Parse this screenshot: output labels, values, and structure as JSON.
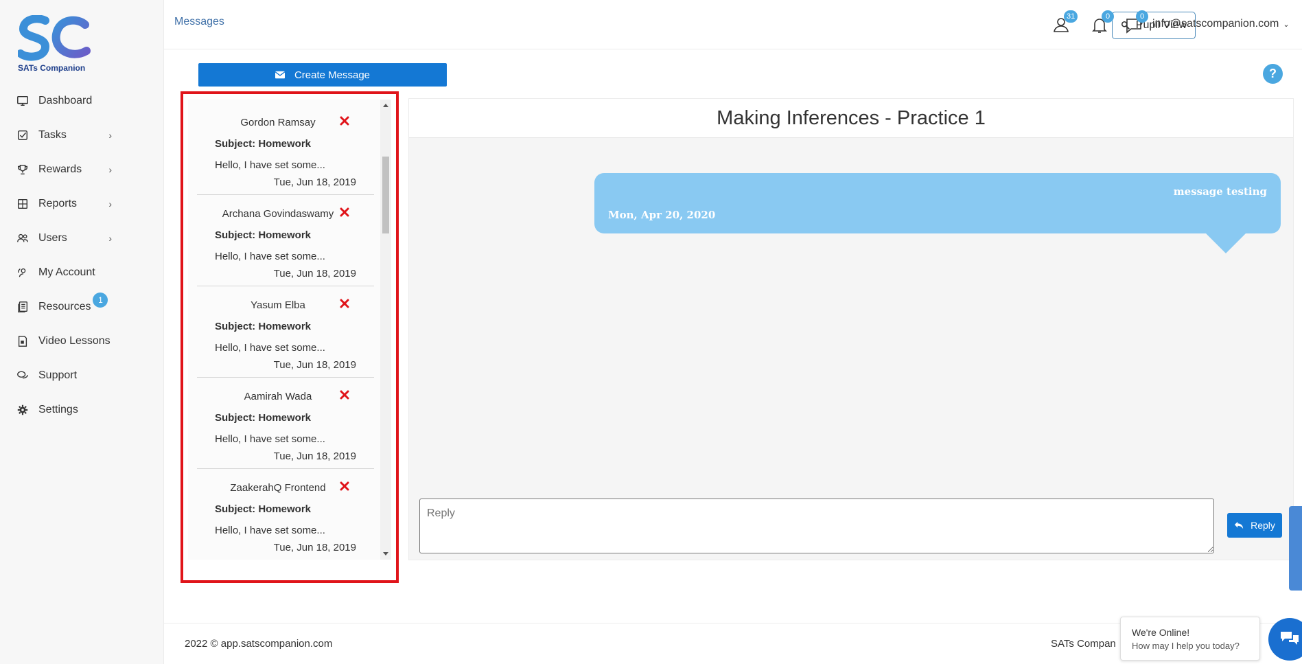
{
  "brand": {
    "name": "SATs Companion",
    "logo_letters": "SC"
  },
  "sidebar": {
    "items": [
      {
        "label": "Dashboard",
        "icon": "monitor-icon",
        "chevron": false
      },
      {
        "label": "Tasks",
        "icon": "task-icon",
        "chevron": true
      },
      {
        "label": "Rewards",
        "icon": "trophy-icon",
        "chevron": true
      },
      {
        "label": "Reports",
        "icon": "report-icon",
        "chevron": true
      },
      {
        "label": "Users",
        "icon": "users-icon",
        "chevron": true
      },
      {
        "label": "My Account",
        "icon": "account-icon",
        "chevron": false
      },
      {
        "label": "Resources",
        "icon": "resources-icon",
        "chevron": false,
        "badge": "1"
      },
      {
        "label": "Video Lessons",
        "icon": "video-icon",
        "chevron": false
      },
      {
        "label": "Support",
        "icon": "chat-icon",
        "chevron": false
      },
      {
        "label": "Settings",
        "icon": "gear-icon",
        "chevron": false
      }
    ]
  },
  "header": {
    "breadcrumb": "Messages",
    "pupil_view": "Pupil View",
    "users_badge": "31",
    "notifications_badge": "0",
    "messages_badge": "0",
    "account": "info@satscompanion.com"
  },
  "main": {
    "create_message": "Create Message",
    "help": "?",
    "messages": [
      {
        "name": "Gordon Ramsay",
        "subject": "Subject: Homework",
        "preview": "Hello, I have set some...",
        "date": "Tue, Jun 18, 2019"
      },
      {
        "name": "Archana Govindaswamy",
        "subject": "Subject: Homework",
        "preview": "Hello, I have set some...",
        "date": "Tue, Jun 18, 2019"
      },
      {
        "name": "Yasum Elba",
        "subject": "Subject: Homework",
        "preview": "Hello, I have set some...",
        "date": "Tue, Jun 18, 2019"
      },
      {
        "name": "Aamirah Wada",
        "subject": "Subject: Homework",
        "preview": "Hello, I have set some...",
        "date": "Tue, Jun 18, 2019"
      },
      {
        "name": "ZaakerahQ Frontend",
        "subject": "Subject: Homework",
        "preview": "Hello, I have set some...",
        "date": "Tue, Jun 18, 2019"
      }
    ],
    "thread": {
      "title": "Making Inferences - Practice 1",
      "bubble_text": "message testing",
      "bubble_date": "Mon, Apr 20, 2020",
      "reply_placeholder": "Reply",
      "reply_button": "Reply"
    }
  },
  "footer": {
    "copyright": "2022 © app.satscompanion.com",
    "right_text": "SATs Compan"
  },
  "chat": {
    "line1": "We're Online!",
    "line2": "How may I help you today?"
  },
  "colors": {
    "accent": "#1478d4",
    "badge": "#4aa7e0",
    "bubble": "#89c9f2",
    "highlight": "#e0141a",
    "delete": "#e0141a"
  }
}
